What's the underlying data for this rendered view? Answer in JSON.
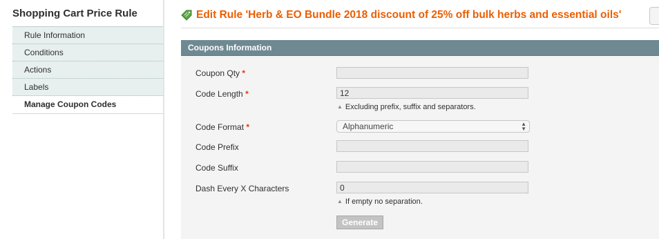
{
  "sidebar": {
    "title": "Shopping Cart Price Rule",
    "items": [
      {
        "label": "Rule Information"
      },
      {
        "label": "Conditions"
      },
      {
        "label": "Actions"
      },
      {
        "label": "Labels"
      },
      {
        "label": "Manage Coupon Codes",
        "active": true
      }
    ]
  },
  "header": {
    "title": "Edit Rule 'Herb & EO Bundle 2018 discount of 25% off bulk herbs and essential oils'",
    "icon": "tag-icon",
    "accent_color": "#eb5e00"
  },
  "coupons": {
    "legend": "Coupons Information",
    "qty": {
      "label": "Coupon Qty",
      "required": "*",
      "value": ""
    },
    "length": {
      "label": "Code Length",
      "required": "*",
      "value": "12",
      "note": "Excluding prefix, suffix and separators."
    },
    "format": {
      "label": "Code Format",
      "required": "*",
      "selected": "Alphanumeric"
    },
    "prefix": {
      "label": "Code Prefix",
      "value": ""
    },
    "suffix": {
      "label": "Code Suffix",
      "value": ""
    },
    "dash": {
      "label": "Dash Every X Characters",
      "value": "0",
      "note": "If empty no separation."
    },
    "generate_label": "Generate"
  }
}
